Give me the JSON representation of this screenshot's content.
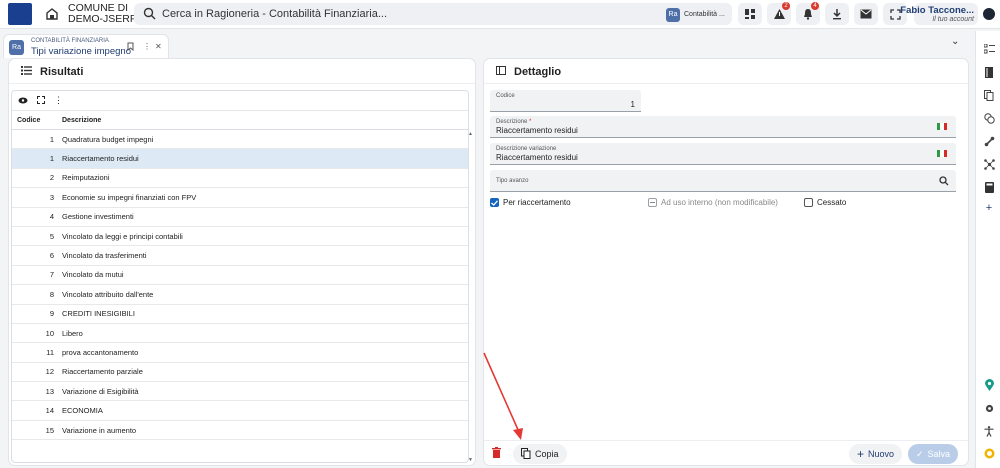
{
  "topbar": {
    "org_line1": "COMUNE DI",
    "org_line2": "DEMO-JSERFIN",
    "search_placeholder": "Cerca in Ragioneria - Contabilità Finanziaria...",
    "context_badge": "Ra",
    "context_label": "Contabilità ...",
    "alerts_count": "2",
    "notifications_count": "4",
    "user_name": "Fabio Taccone...",
    "user_role": "Il tuo account"
  },
  "tab": {
    "badge": "Ra",
    "section": "CONTABILITÀ FINANZIARIA",
    "title": "Tipi variazione impegno"
  },
  "results": {
    "title": "Risultati",
    "columns": [
      "Codice",
      "Descrizione"
    ],
    "rows": [
      {
        "code": "1",
        "desc": "Quadratura budget impegni"
      },
      {
        "code": "1",
        "desc": "Riaccertamento residui"
      },
      {
        "code": "2",
        "desc": "Reimputazioni"
      },
      {
        "code": "3",
        "desc": "Economie su impegni finanziati con FPV"
      },
      {
        "code": "4",
        "desc": "Gestione investimenti"
      },
      {
        "code": "5",
        "desc": "Vincolato da leggi e principi contabili"
      },
      {
        "code": "6",
        "desc": "Vincolato da trasferimenti"
      },
      {
        "code": "7",
        "desc": "Vincolato da mutui"
      },
      {
        "code": "8",
        "desc": "Vincolato attribuito dall'ente"
      },
      {
        "code": "9",
        "desc": "CREDITI INESIGIBILI"
      },
      {
        "code": "10",
        "desc": "Libero"
      },
      {
        "code": "11",
        "desc": "prova accantonamento"
      },
      {
        "code": "12",
        "desc": "Riaccertamento parziale"
      },
      {
        "code": "13",
        "desc": "Variazione di Esigibilità"
      },
      {
        "code": "14",
        "desc": "ECONOMIA"
      },
      {
        "code": "15",
        "desc": "Variazione in aumento"
      }
    ],
    "selected_index": 1
  },
  "detail": {
    "title": "Dettaglio",
    "codice_label": "Codice",
    "codice_value": "1",
    "descrizione_label": "Descrizione",
    "descrizione_required": "*",
    "descrizione_value": "Riaccertamento residui",
    "descrizione_variazione_label": "Descrizione variazione",
    "descrizione_variazione_value": "Riaccertamento residui",
    "tipo_avanzo_label": "Tipo avanzo",
    "checkbox_riaccertamento": "Per riaccertamento",
    "checkbox_uso_interno": "Ad uso interno (non modificabile)",
    "checkbox_cessato": "Cessato",
    "btn_copy": "Copia",
    "btn_new": "Nuovo",
    "btn_save": "Salva"
  },
  "colors": {
    "accent": "#1565c0",
    "selected_row": "#dde9f5",
    "annotation_arrow": "#e53935",
    "danger": "#d62929"
  }
}
